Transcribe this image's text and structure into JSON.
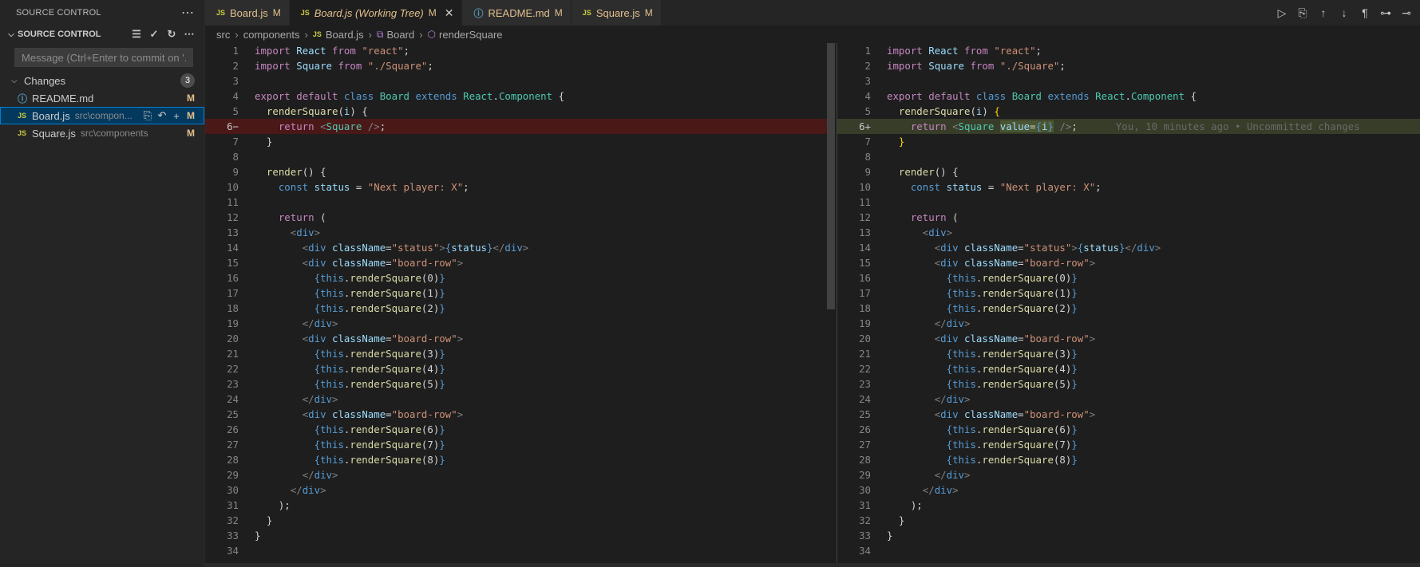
{
  "sidebar": {
    "header": "SOURCE CONTROL",
    "section_title": "SOURCE CONTROL",
    "message_placeholder": "Message (Ctrl+Enter to commit on '...",
    "changes_label": "Changes",
    "changes_count": "3",
    "files": [
      {
        "icon": "info",
        "name": "README.md",
        "path": "",
        "status": "M"
      },
      {
        "icon": "JS",
        "name": "Board.js",
        "path": "src\\compon...",
        "status": "M"
      },
      {
        "icon": "JS",
        "name": "Square.js",
        "path": "src\\components",
        "status": "M"
      }
    ]
  },
  "tabs": [
    {
      "icon": "JS",
      "label": "Board.js",
      "status": "M"
    },
    {
      "icon": "JS",
      "label": "Board.js (Working Tree)",
      "status": "M",
      "active": true
    },
    {
      "icon": "info",
      "label": "README.md",
      "status": "M"
    },
    {
      "icon": "JS",
      "label": "Square.js",
      "status": "M"
    }
  ],
  "breadcrumb": {
    "parts": [
      "src",
      "components",
      "Board.js",
      "Board",
      "renderSquare"
    ]
  },
  "diff": {
    "blame": "You, 10 minutes ago • Uncommitted changes",
    "line_numbers": [
      "1",
      "2",
      "3",
      "4",
      "5",
      "6",
      "7",
      "8",
      "9",
      "10",
      "11",
      "12",
      "13",
      "14",
      "15",
      "16",
      "17",
      "18",
      "19",
      "20",
      "21",
      "22",
      "23",
      "24",
      "25",
      "26",
      "27",
      "28",
      "29",
      "30",
      "31",
      "32",
      "33",
      "34"
    ],
    "del_marker": "6−",
    "add_marker": "6+"
  },
  "colors": {
    "deleted_bg": "#4b1818",
    "added_bg": "#373d29",
    "modified_text": "#e2c08d",
    "accent": "#007fd4"
  }
}
